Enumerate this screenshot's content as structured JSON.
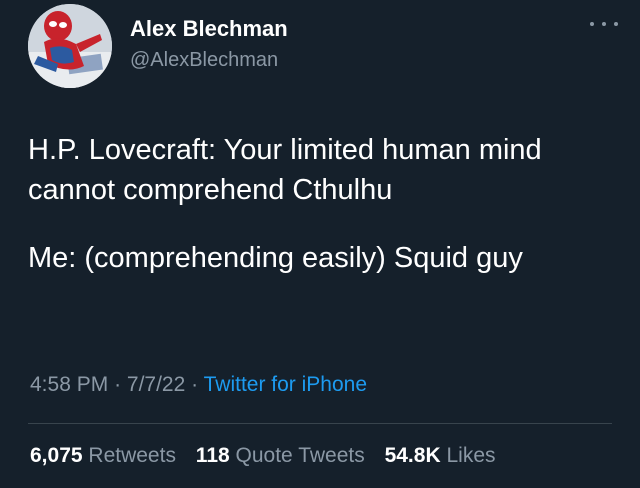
{
  "author": {
    "name": "Alex Blechman",
    "handle": "@AlexBlechman",
    "avatar_icon": "spiderman-avatar-icon"
  },
  "more_icon": "more-options-icon",
  "tweet": {
    "lines": [
      "H.P. Lovecraft: Your limited human mind cannot comprehend Cthulhu",
      "Me: (comprehending easily) Squid guy"
    ]
  },
  "meta": {
    "time": "4:58 PM",
    "date": "7/7/22",
    "source": "Twitter for iPhone",
    "separator": "·"
  },
  "stats": {
    "retweets_count": "6,075",
    "retweets_label": "Retweets",
    "quotes_count": "118",
    "quotes_label": "Quote Tweets",
    "likes_count": "54.8K",
    "likes_label": "Likes"
  },
  "colors": {
    "background": "#15202b",
    "text": "#ffffff",
    "secondary": "#8b98a5",
    "accent": "#1d9bf0",
    "divider": "#38444d"
  }
}
